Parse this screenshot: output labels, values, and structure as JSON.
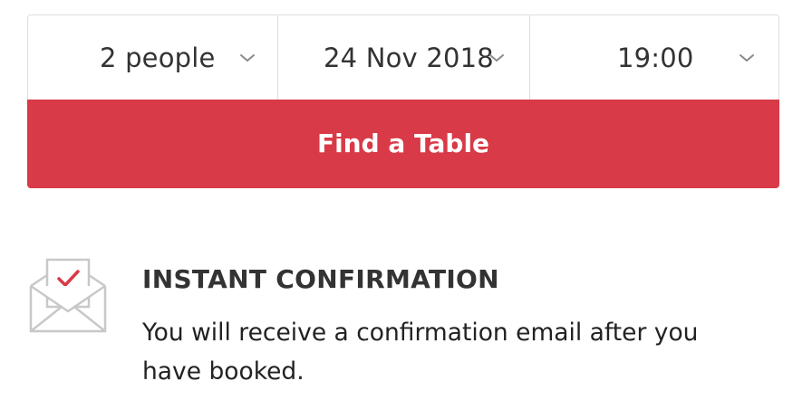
{
  "booking": {
    "party_size": "2 people",
    "date": "24 Nov 2018",
    "time": "19:00",
    "find_label": "Find a Table"
  },
  "confirmation": {
    "title": "INSTANT CONFIRMATION",
    "text": "You will receive a confirmation email after you have booked."
  },
  "icons": {
    "selector_chevron": "chevron-down-icon",
    "confirmation": "envelope-check-icon"
  },
  "colors": {
    "accent": "#d83a47",
    "border": "#dedede",
    "icon_gray": "#c8c8c8",
    "text": "#333333"
  }
}
